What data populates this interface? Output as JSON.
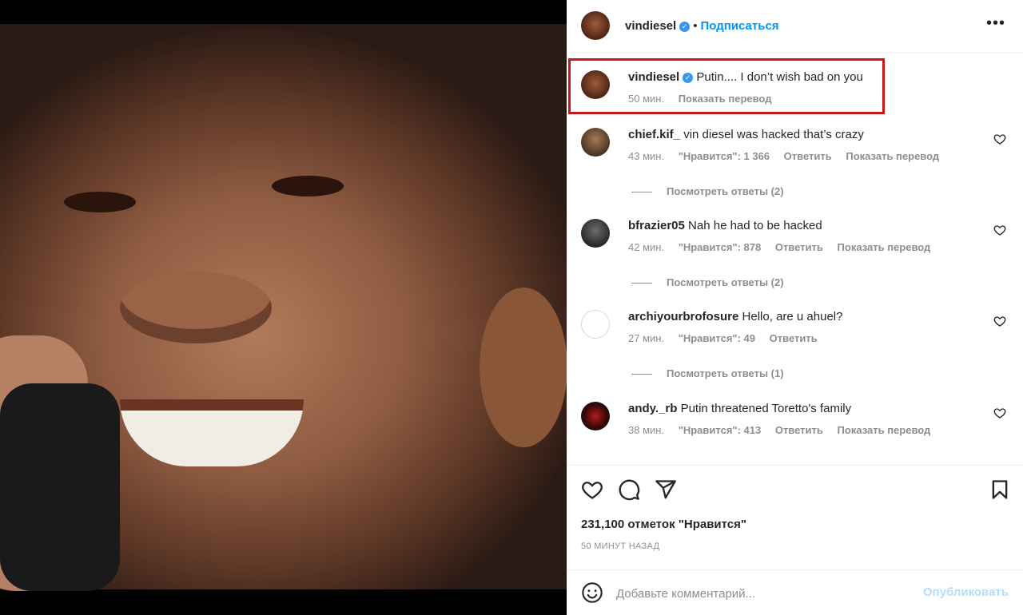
{
  "post": {
    "author": "vindiesel",
    "follow_label": "Подписаться",
    "dot": "•",
    "more_label": "•••"
  },
  "caption": {
    "user": "vindiesel",
    "text": "Putin.... I don’t wish bad on you",
    "time": "50 мин.",
    "translate": "Показать перевод"
  },
  "comments": [
    {
      "user": "chief.kif_",
      "text": "vin diesel was hacked that’s crazy",
      "time": "43 мин.",
      "likes": "\"Нравится\": 1 366",
      "reply": "Ответить",
      "translate": "Показать перевод",
      "replies": "Посмотреть ответы (2)"
    },
    {
      "user": "bfrazier05",
      "text": "Nah he had to be hacked",
      "time": "42 мин.",
      "likes": "\"Нравится\": 878",
      "reply": "Ответить",
      "translate": "Показать перевод",
      "replies": "Посмотреть ответы (2)"
    },
    {
      "user": "archiyourbrofosure",
      "text": "Hello, are u ahuel?",
      "time": "27 мин.",
      "likes": "\"Нравится\": 49",
      "reply": "Ответить",
      "translate": "",
      "replies": "Посмотреть ответы (1)"
    },
    {
      "user": "andy._rb",
      "text": "Putin threatened Toretto's family",
      "time": "38 мин.",
      "likes": "\"Нравится\": 413",
      "reply": "Ответить",
      "translate": "Показать перевод",
      "replies": ""
    }
  ],
  "actions": {
    "likes_count": "231,100 отметок \"Нравится\"",
    "posted_ago": "50 МИНУТ НАЗАД",
    "icons": [
      "heart-icon",
      "comment-icon",
      "share-icon",
      "bookmark-icon"
    ]
  },
  "composer": {
    "placeholder": "Добавьте комментарий...",
    "publish_label": "Опубликовать"
  },
  "colors": {
    "accent": "#0095f6",
    "highlight_box": "#c8171d",
    "verified": "#3897f0",
    "muted": "#8e8e8e"
  }
}
